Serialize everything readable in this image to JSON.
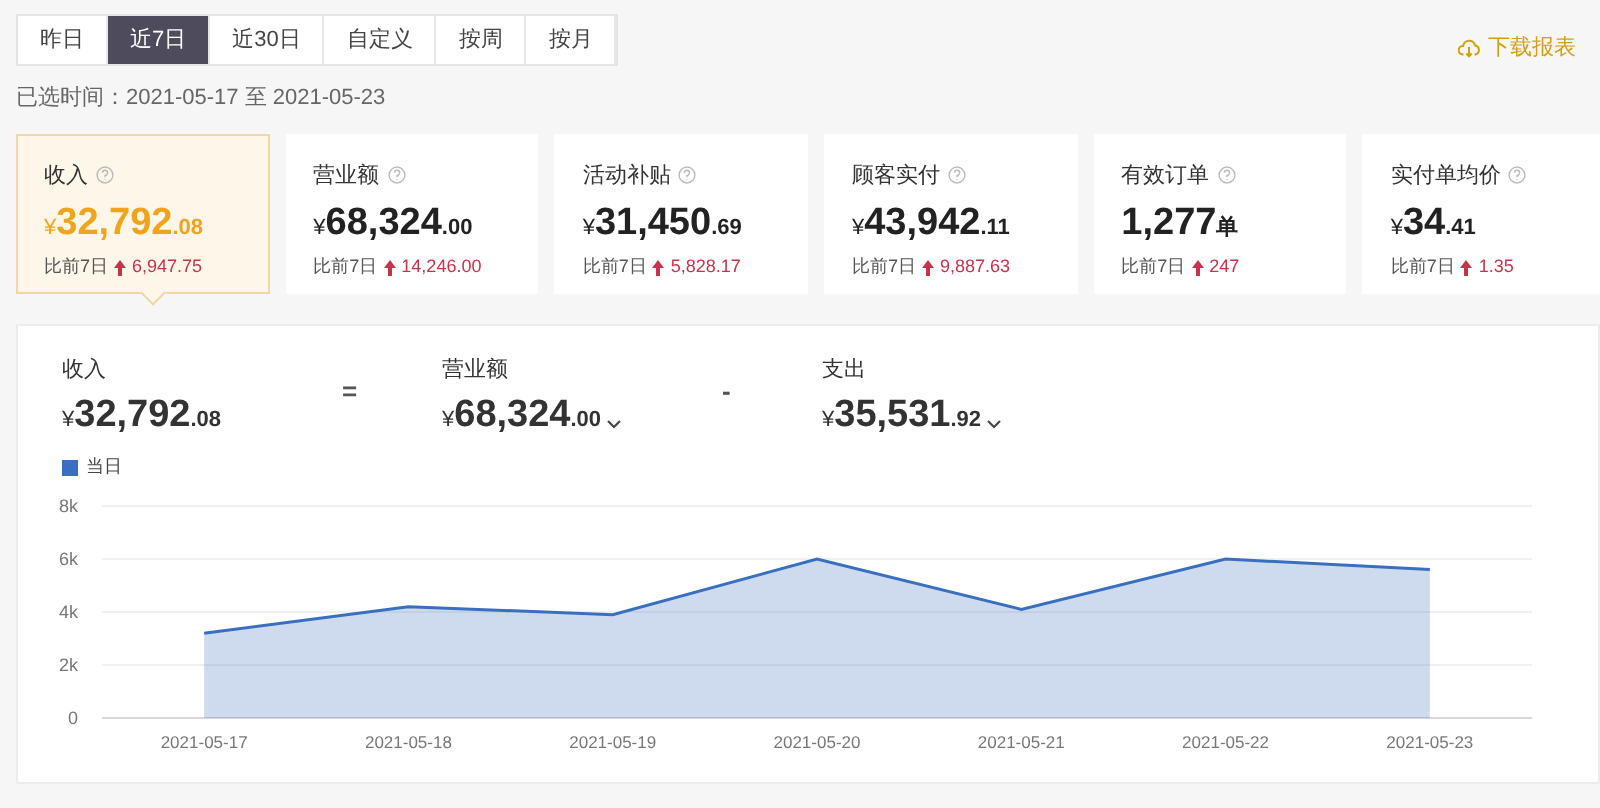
{
  "tabs": [
    {
      "label": "昨日",
      "selected": false
    },
    {
      "label": "近7日",
      "selected": true
    },
    {
      "label": "近30日",
      "selected": false
    },
    {
      "label": "自定义",
      "selected": false
    },
    {
      "label": "按周",
      "selected": false
    },
    {
      "label": "按月",
      "selected": false
    }
  ],
  "download": {
    "label": "下载报表"
  },
  "date_range": "已选时间：2021-05-17 至 2021-05-23",
  "cards": [
    {
      "title": "收入",
      "value": "¥32,792.08",
      "compare_label": "比前7日",
      "change": "6,947.75",
      "selected": true
    },
    {
      "title": "营业额",
      "value": "¥68,324.00",
      "compare_label": "比前7日",
      "change": "14,246.00",
      "selected": false
    },
    {
      "title": "活动补贴",
      "value": "¥31,450.69",
      "compare_label": "比前7日",
      "change": "5,828.17",
      "selected": false
    },
    {
      "title": "顾客实付",
      "value": "¥43,942.11",
      "compare_label": "比前7日",
      "change": "9,887.63",
      "selected": false
    },
    {
      "title": "有效订单",
      "value": "1,277单",
      "compare_label": "比前7日",
      "change": "247",
      "selected": false
    },
    {
      "title": "实付单均价",
      "value": "¥34.41",
      "compare_label": "比前7日",
      "change": "1.35",
      "selected": false
    }
  ],
  "formula": [
    {
      "kind": "term",
      "label": "收入",
      "value": "¥32,792.08",
      "dropdown": false
    },
    {
      "kind": "operator",
      "text": "="
    },
    {
      "kind": "term",
      "label": "营业额",
      "value": "¥68,324.00",
      "dropdown": true
    },
    {
      "kind": "operator",
      "text": "-"
    },
    {
      "kind": "term",
      "label": "支出",
      "value": "¥35,531.92",
      "dropdown": true
    }
  ],
  "chart_data": {
    "type": "area",
    "categories": [
      "2021-05-17",
      "2021-05-18",
      "2021-05-19",
      "2021-05-20",
      "2021-05-21",
      "2021-05-22",
      "2021-05-23"
    ],
    "grid": true,
    "series": [
      {
        "name": "当日",
        "color": "#3a6fbf",
        "values": [
          3200,
          4200,
          3900,
          6000,
          4100,
          6000,
          5600
        ]
      }
    ],
    "ylim": [
      0,
      8000
    ],
    "yticks": [
      {
        "value": 0,
        "label": "0"
      },
      {
        "value": 2000,
        "label": "2k"
      },
      {
        "value": 4000,
        "label": "4k"
      },
      {
        "value": 6000,
        "label": "6k"
      },
      {
        "value": 8000,
        "label": "8k"
      }
    ]
  }
}
